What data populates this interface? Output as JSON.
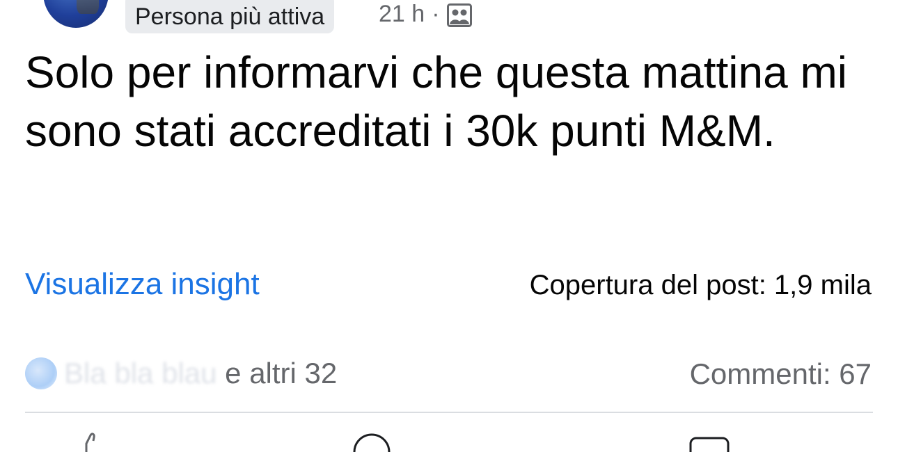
{
  "post": {
    "badge": "Persona più attiva",
    "time": "21 h",
    "separator": "·",
    "audience_icon": "group-icon",
    "text": "Solo per informarvi che questa mattina mi sono stati accreditati i 30k punti M&M."
  },
  "insights": {
    "link_label": "Visualizza insight",
    "reach_label": "Copertura del post: 1,9 mila"
  },
  "engagement": {
    "reactors_hidden": "Bla bla blau",
    "reactors_suffix": " e altri 32",
    "comments_label": "Commenti: 67"
  },
  "actions": {
    "icons": [
      "like-icon",
      "comment-icon",
      "share-icon"
    ]
  },
  "colors": {
    "link": "#1b74e4",
    "secondary_text": "#65676b",
    "badge_bg": "#e9ebee",
    "divider": "#dadde1"
  }
}
